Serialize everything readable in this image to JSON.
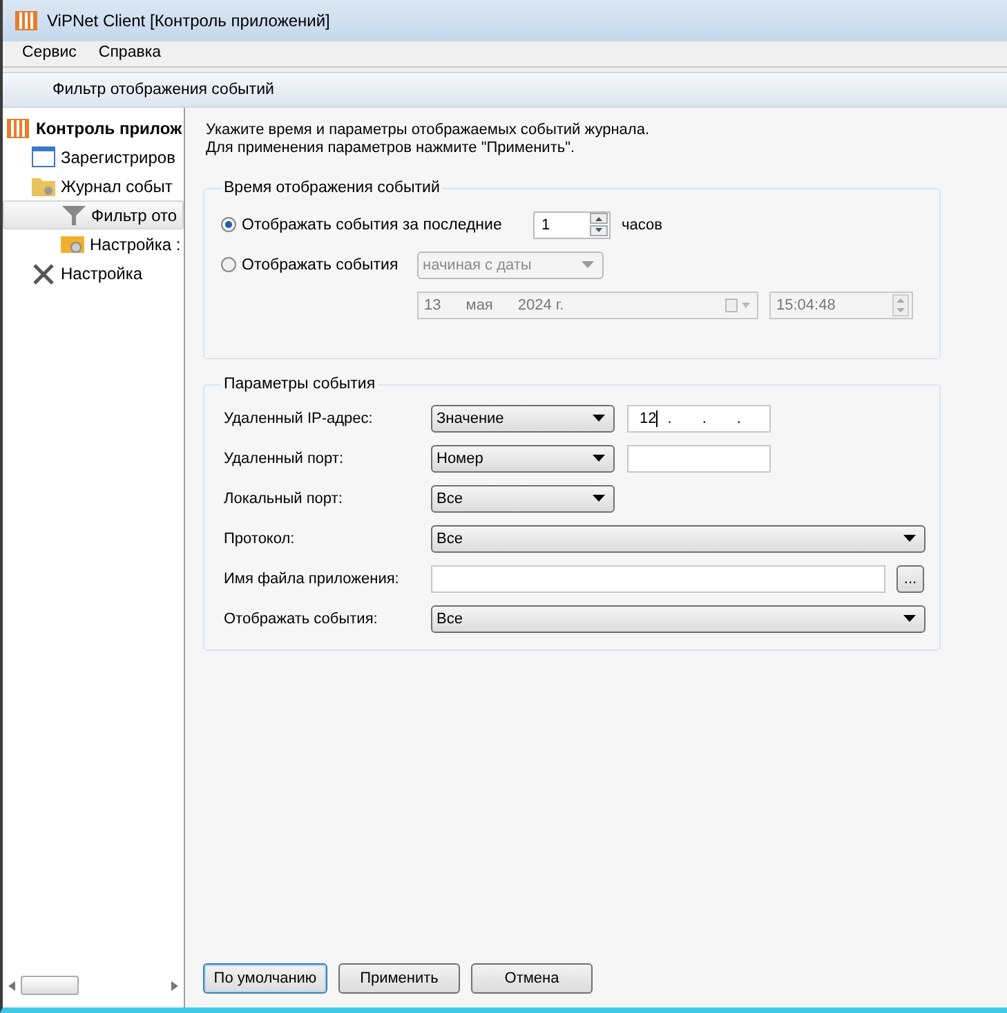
{
  "window": {
    "title": "ViPNet Client [Контроль приложений]"
  },
  "menu": [
    "Сервис",
    "Справка"
  ],
  "header": {
    "title": "Фильтр отображения событий"
  },
  "tree": [
    {
      "label": "Контроль прилож",
      "kind": "app",
      "selected": false,
      "children": [
        {
          "label": "Зарегистриров",
          "kind": "window",
          "selected": false
        },
        {
          "label": "Журнал событ",
          "kind": "folder",
          "selected": false,
          "children": [
            {
              "label": "Фильтр ото",
              "kind": "filter",
              "selected": true
            },
            {
              "label": "Настройка :",
              "kind": "settings",
              "selected": false
            }
          ]
        },
        {
          "label": "Настройка",
          "kind": "tools",
          "selected": false
        }
      ]
    }
  ],
  "intro": [
    "Укажите время и параметры отображаемых событий журнала.",
    "Для применения параметров нажмите \"Применить\"."
  ],
  "time_group": {
    "title": "Время отображения событий",
    "last": {
      "label": "Отображать события за последние",
      "selected": true,
      "value": "1",
      "unit": "часов"
    },
    "range": {
      "label": "Отображать события",
      "selected": false,
      "mode": "начиная с даты",
      "disabled": true,
      "day": "13",
      "month": "мая",
      "year": "2024 г.",
      "time": "15:04:48"
    }
  },
  "params_group": {
    "title": "Параметры события",
    "rows": [
      {
        "kind": "combo-field",
        "label": "Удаленный IP-адрес:",
        "combo": "Значение",
        "value": "12",
        "separators": [
          ".",
          ".",
          "."
        ]
      },
      {
        "kind": "combo-field",
        "label": "Удаленный порт:",
        "combo": "Номер",
        "value": ""
      },
      {
        "kind": "combo",
        "label": "Локальный порт:",
        "combo": "Все"
      },
      {
        "kind": "wide-combo",
        "label": "Протокол:",
        "combo": "Все"
      },
      {
        "kind": "file",
        "label": "Имя файла приложения:",
        "value": "",
        "browse": "..."
      },
      {
        "kind": "wide-combo",
        "label": "Отображать события:",
        "combo": "Все"
      }
    ]
  },
  "buttons": [
    {
      "label": "По умолчанию",
      "focused": true
    },
    {
      "label": "Применить",
      "focused": false
    },
    {
      "label": "Отмена",
      "focused": false
    }
  ]
}
